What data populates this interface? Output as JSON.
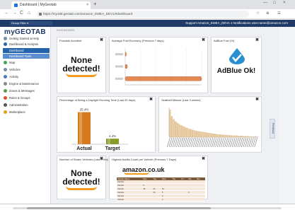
{
  "browser": {
    "tab_title": "Dashboard | MyGeotab",
    "tab_close": "×",
    "new_tab": "+",
    "url": "https://my168.geotab.com/amazon_EMEA_DEV1/#dashboard",
    "back": "←",
    "forward": "→",
    "reload": "C",
    "home": "⌂",
    "extensions": [
      "☆",
      "⊕",
      "☰"
    ],
    "window_controls": [
      "—",
      "□",
      "×"
    ]
  },
  "topbar": {
    "db_label": "Group Filter",
    "db_value": "▾",
    "right_text": "Support  Amazon_EMEA_DEV1  2 Notifications   user.name@amazon.com"
  },
  "sidebar": {
    "logo": "myGEOTAB",
    "items": [
      {
        "label": "Getting Started & Help"
      },
      {
        "label": "Dashboard & Analysis"
      },
      {
        "label": "Dashboard"
      },
      {
        "label": "Dashboard Tools"
      },
      {
        "label": "Map"
      },
      {
        "label": "Vehicles"
      },
      {
        "label": "Activity"
      },
      {
        "label": "Engine & Maintenance"
      },
      {
        "label": "Zones & Messages"
      },
      {
        "label": "Rules & Groups"
      },
      {
        "label": "Administration"
      },
      {
        "label": "Marketplace"
      }
    ]
  },
  "main": {
    "breadcrumb": "DASHBOARD",
    "side_tab": "Feedback",
    "panels": {
      "p1": {
        "title": "Possible Accident",
        "text_line1": "None",
        "text_line2": "detected!"
      },
      "p2": {
        "title": "Average Fuel Economy (Previous 7 days)"
      },
      "p3": {
        "title": "AdBlue Fuel (%)",
        "text": "AdBlue Ok!"
      },
      "p4": {
        "title": "Percentage of Being a Daylight Running Time (Last 30 days)"
      },
      "p5": {
        "title": "Seatbelt Misuse (Last 3 weeks)"
      },
      "p6": {
        "title": "Number of Stolen Vehicles (Last 3 Hrs)",
        "text_line1": "None",
        "text_line2": "detected!"
      },
      "p7": {
        "title": "Highest Audits Count per Vehicle (Previous 7 Days)",
        "brand": "amazon.co.uk"
      }
    },
    "close_glyph": "✖",
    "table": {
      "headers": [
        "Vehicle Name",
        "Mon",
        "Tue",
        "Wed",
        "Thu",
        "Fri",
        "Sat",
        "Sun"
      ],
      "rows": [
        [
          "Vehicle",
          "",
          "",
          "",
          "",
          "",
          "",
          ""
        ],
        [
          "Vehicle",
          "2",
          "",
          "",
          "",
          "",
          "",
          ""
        ],
        [
          "Vehicle",
          "16",
          "14",
          "12",
          "",
          "",
          "",
          ""
        ],
        [
          "Vehicle",
          "",
          "10",
          "5",
          "",
          "",
          "2",
          ""
        ],
        [
          "Vehicle",
          "",
          "",
          "4",
          "",
          "",
          "",
          ""
        ],
        [
          "Vehicle",
          "",
          "",
          "3",
          "",
          "",
          "",
          ""
        ]
      ]
    }
  },
  "chart_data": [
    {
      "type": "bar",
      "orientation": "horizontal",
      "categories": [
        "",
        "",
        ""
      ],
      "values": [
        0.3,
        2.8,
        100
      ],
      "xlim": [
        0,
        100
      ],
      "colors": [
        "#e38a52"
      ]
    },
    {
      "type": "bar",
      "categories": [
        "Actual",
        "Target"
      ],
      "values": [
        25.4,
        4.4
      ],
      "value_labels": [
        "25.4%",
        "4.4%"
      ],
      "colors": [
        "#d67a1d",
        "#8c9a2a"
      ]
    },
    {
      "type": "bar",
      "categories": [],
      "values": [
        92,
        70,
        60,
        53,
        48,
        44,
        40,
        37,
        34,
        31,
        29,
        27,
        25,
        23,
        21,
        20,
        19,
        18,
        17,
        16,
        15,
        14,
        13,
        12,
        11,
        10,
        9,
        9,
        8,
        8,
        7,
        7,
        6,
        6,
        5,
        5,
        5,
        4,
        4,
        4,
        3,
        3,
        3,
        2,
        2,
        2,
        2,
        1
      ],
      "colors": [
        "#e9c99a"
      ]
    }
  ]
}
